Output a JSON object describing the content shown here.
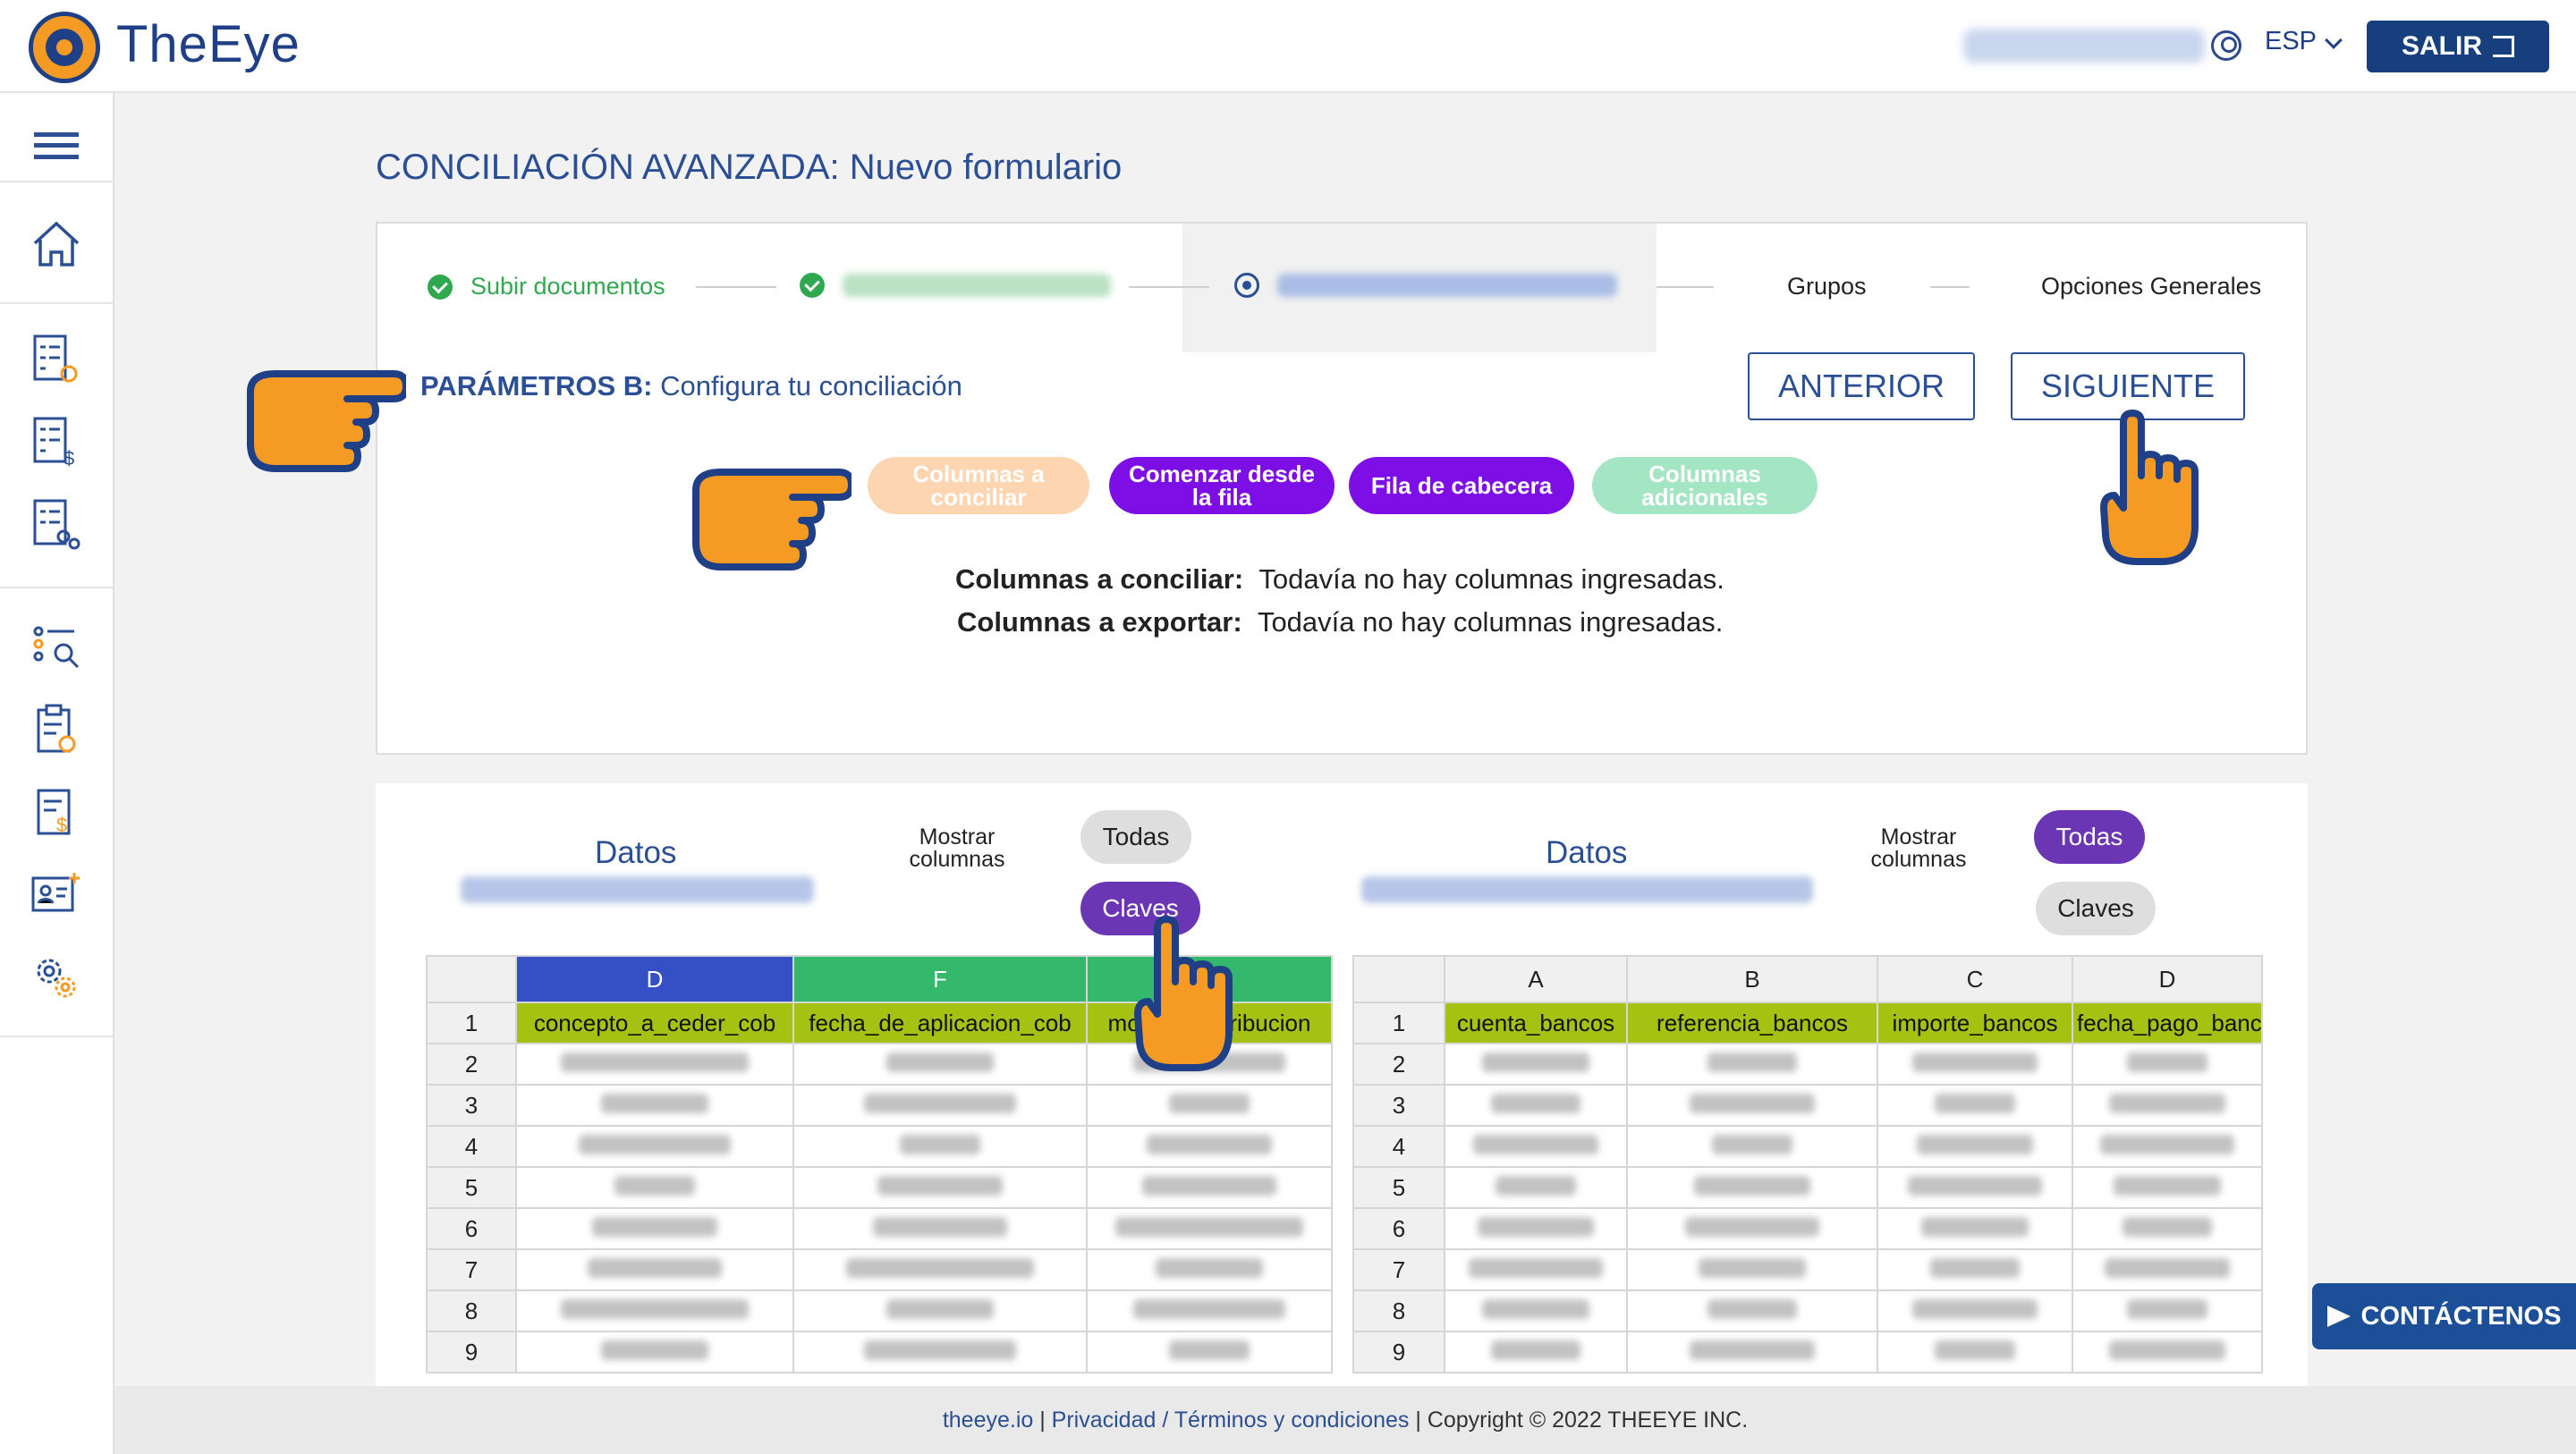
{
  "header": {
    "brand": "TheEye",
    "lang": "ESP",
    "logout_label": "SALIR"
  },
  "sidebar": {
    "items": [
      "menu-icon",
      "home-icon",
      "checklist-settings-icon",
      "checklist-money-icon",
      "checklist-gears-icon",
      "search-list-icon",
      "clipboard-clock-icon",
      "invoice-dollar-icon",
      "user-card-add-icon",
      "gears-icon"
    ]
  },
  "page": {
    "title": "CONCILIACIÓN AVANZADA:  Nuevo formulario"
  },
  "steps": [
    {
      "label": "Subir documentos",
      "state": "done"
    },
    {
      "label": "",
      "state": "done"
    },
    {
      "label": "",
      "state": "active"
    },
    {
      "label": "Grupos",
      "state": "pending"
    },
    {
      "label": "Opciones Generales",
      "state": "pending"
    }
  ],
  "params": {
    "title_bold": "PARÁMETROS B:",
    "title_rest": " Configura tu conciliación",
    "prev_label": "ANTERIOR",
    "next_label": "SIGUIENTE",
    "chips": [
      {
        "label": "Columnas a conciliar",
        "color": "#fdd5b1"
      },
      {
        "label": "Comenzar desde la fila",
        "color": "#7d0fe6"
      },
      {
        "label": "Fila de cabecera",
        "color": "#7d0fe6"
      },
      {
        "label": "Columnas adicionales",
        "color": "#a4e5c3"
      }
    ],
    "conciliar_key": "Columnas a conciliar:",
    "conciliar_val": "Todavía no hay columnas ingresadas.",
    "exportar_key": "Columnas a exportar:",
    "exportar_val": "Todavía no hay columnas ingresadas."
  },
  "left_panel": {
    "title": "Datos",
    "show_label": "Mostrar columnas",
    "todas": "Todas",
    "claves": "Claves",
    "selected": "Claves",
    "columns": [
      "D",
      "F",
      ""
    ],
    "column_colors": [
      "#3550c4",
      "#34b86c",
      "#34b86c"
    ],
    "headers": [
      "concepto_a_ceder_cob",
      "fecha_de_aplicacion_cob",
      "monto_contribucion"
    ],
    "rows": [
      "1",
      "2",
      "3",
      "4",
      "5",
      "6",
      "7",
      "8",
      "9"
    ]
  },
  "right_panel": {
    "title": "Datos",
    "show_label": "Mostrar columnas",
    "todas": "Todas",
    "claves": "Claves",
    "selected": "Todas",
    "columns": [
      "A",
      "B",
      "C",
      "D"
    ],
    "headers": [
      "cuenta_bancos",
      "referencia_bancos",
      "importe_bancos",
      "fecha_pago_bancos"
    ],
    "rows": [
      "1",
      "2",
      "3",
      "4",
      "5",
      "6",
      "7",
      "8",
      "9"
    ]
  },
  "footer": {
    "site": "theeye.io",
    "sep1": " | ",
    "privacy": "Privacidad / Términos y condiciones",
    "sep2": " | ",
    "copyright": "Copyright © 2022 THEEYE INC."
  },
  "contact_label": "CONTÁCTENOS",
  "colors": {
    "primary": "#2b4f94",
    "navy": "#173f7e",
    "orange": "#f59a23",
    "purple": "#7d0fe6",
    "success": "#2fa84f",
    "header_row": "#a5c212"
  }
}
